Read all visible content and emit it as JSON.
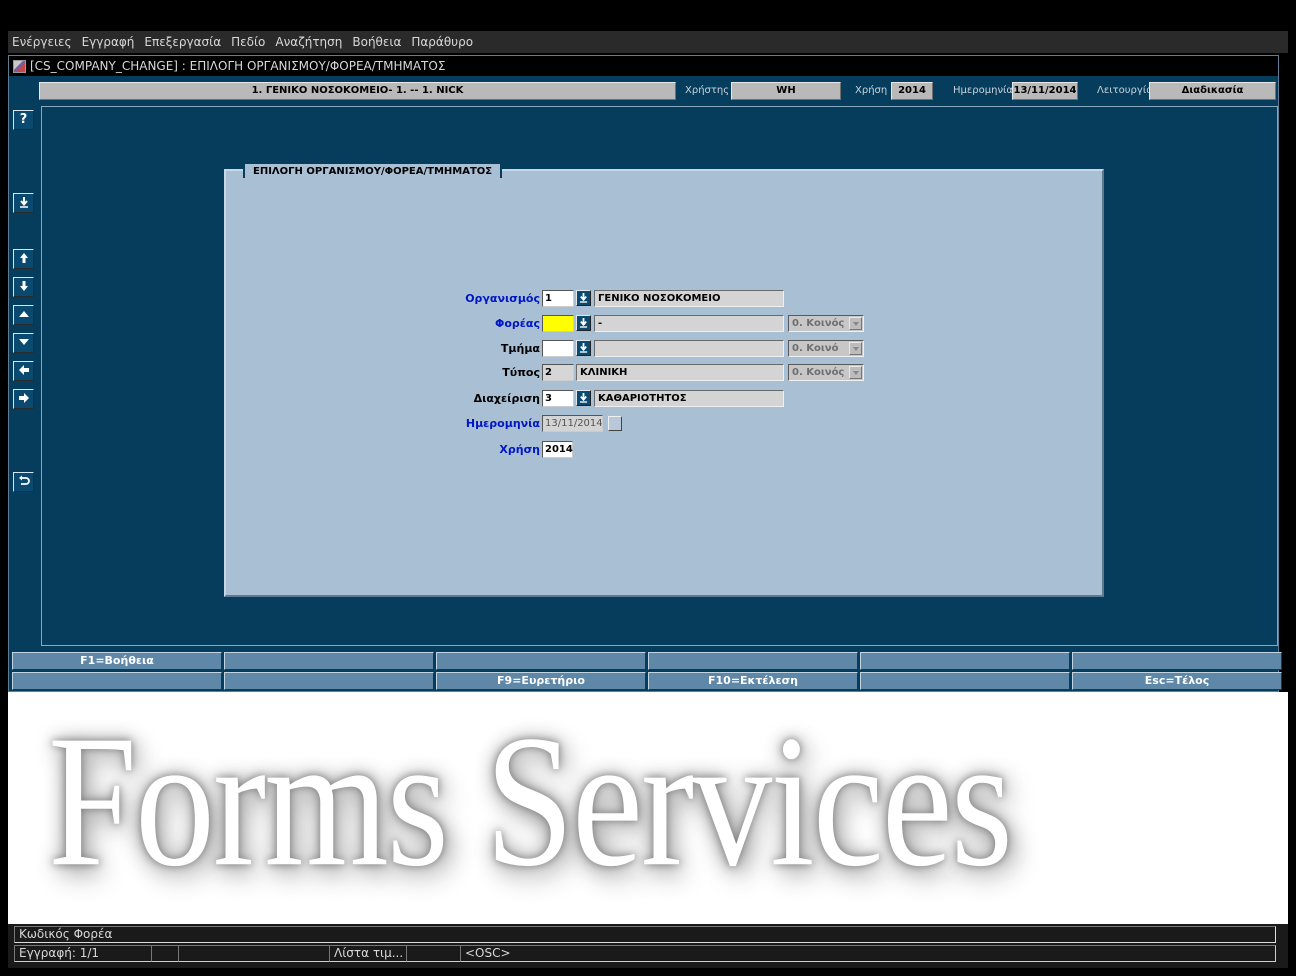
{
  "menu": [
    "Ενέργειες",
    "Εγγραφή",
    "Επεξεργασία",
    "Πεδίο",
    "Αναζήτηση",
    "Βοήθεια",
    "Παράθυρο"
  ],
  "window": {
    "title": "[CS_COMPANY_CHANGE]  :  ΕΠΙΛΟΓΗ ΟΡΓΑΝΙΣΜΟΥ/ΦΟΡΕΑ/ΤΜΗΜΑΤΟΣ"
  },
  "header": {
    "organization": "1. ΓΕΝΙΚΟ ΝΟΣΟΚΟΜΕΙΟ- 1. -- 1. NICK",
    "user_label": "Χρήστης",
    "user": "WH",
    "year_label": "Χρήση",
    "year": "2014",
    "date_label": "Ημερομηνία",
    "date": "13/11/2014",
    "function_label": "Λειτουργία",
    "function": "Διαδικασία"
  },
  "toolbar": {
    "help": "?"
  },
  "form": {
    "panel_title": "ΕΠΙΛΟΓΗ ΟΡΓΑΝΙΣΜΟΥ/ΦΟΡΕΑ/ΤΜΗΜΑΤΟΣ",
    "organismos": {
      "label": "Οργανισμός",
      "code": "1",
      "desc": "ΓΕΝΙΚΟ ΝΟΣΟΚΟΜΕΙΟ"
    },
    "foreas": {
      "label": "Φορέας",
      "code": "",
      "desc": "-",
      "select": "0. Κοινός"
    },
    "tmima": {
      "label": "Τμήμα",
      "code": "",
      "desc": "",
      "select": "0. Κοινό"
    },
    "typos": {
      "label": "Τύπος",
      "code": "2",
      "desc": "ΚΛΙΝΙΚΗ",
      "select": "0. Κοινός"
    },
    "diaxeirisi": {
      "label": "Διαχείριση",
      "code": "3",
      "desc": "ΚΑΘΑΡΙΟΤΗΤΟΣ"
    },
    "imerominia": {
      "label": "Ημερομηνία",
      "value": "13/11/2014"
    },
    "xrisi": {
      "label": "Χρήση",
      "value": "2014"
    }
  },
  "fkeys": {
    "row1": [
      "F1=Βοήθεια",
      "",
      "",
      "",
      "",
      ""
    ],
    "row2": [
      "",
      "",
      "F9=Ευρετήριο",
      "F10=Εκτέλεση",
      "",
      "Esc=Τέλος"
    ]
  },
  "watermark": "Forms Services",
  "status": {
    "message": "Κωδικός Φορέα",
    "record": "Εγγραφή: 1/1",
    "list": "Λίστα τιμ...",
    "osc": "<OSC>"
  },
  "colors": {
    "window_bg": "#073d5c",
    "panel_bg": "#a9bfd4",
    "active_field": "#ffff00",
    "required_label": "#0016c4"
  }
}
